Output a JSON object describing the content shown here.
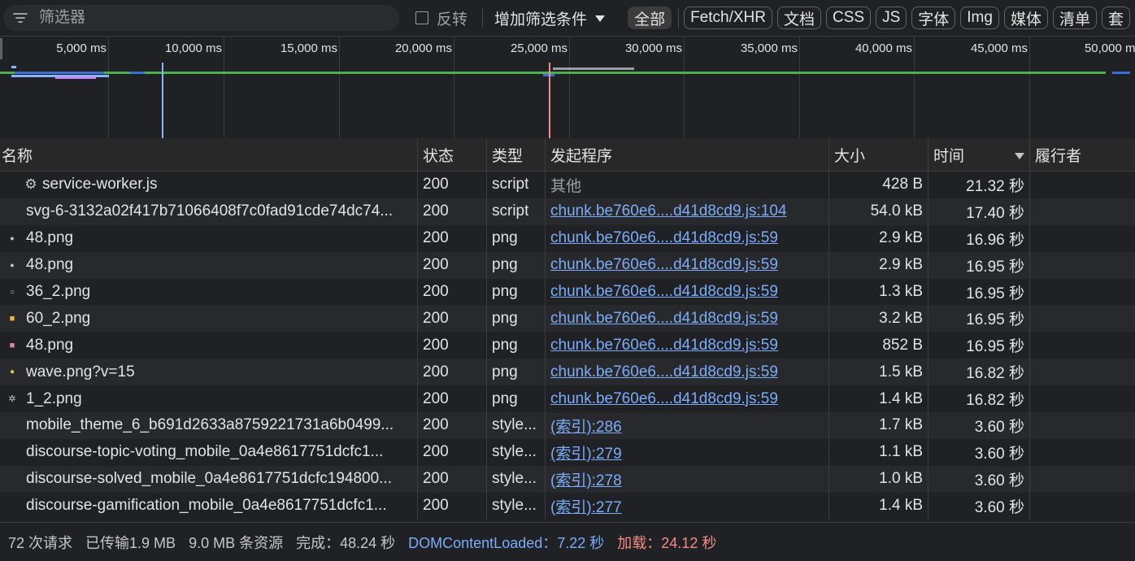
{
  "filter": {
    "placeholder": "筛选器",
    "invert_label": "反转",
    "more_filters_label": "增加筛选条件",
    "types": [
      "全部",
      "Fetch/XHR",
      "文档",
      "CSS",
      "JS",
      "字体",
      "Img",
      "媒体",
      "清单",
      "套"
    ]
  },
  "overview": {
    "ticks": [
      "5,000 ms",
      "10,000 ms",
      "15,000 ms",
      "20,000 ms",
      "25,000 ms",
      "30,000 ms",
      "35,000 ms",
      "40,000 ms",
      "45,000 ms",
      "50,000 ms"
    ],
    "dom_content_loaded_color": "#8ab4f8",
    "load_color": "#f28b82"
  },
  "table": {
    "headers": {
      "name": "名称",
      "status": "状态",
      "type": "类型",
      "initiator": "发起程序",
      "size": "大小",
      "time": "时间",
      "fulfilled_by": "履行者"
    },
    "rows": [
      {
        "icon": "gear-icon",
        "name": "service-worker.js",
        "status": "200",
        "type": "script",
        "initiator": "其他",
        "initiator_link": false,
        "size": "428 B",
        "time": "21.32 秒"
      },
      {
        "icon": "",
        "name": "svg-6-3132a02f417b71066408f7c0fad91cde74dc74...",
        "status": "200",
        "type": "script",
        "initiator": "chunk.be760e6....d41d8cd9.js:104",
        "initiator_link": true,
        "size": "54.0 kB",
        "time": "17.40 秒"
      },
      {
        "icon": "avatar-thumb-icon",
        "name": "48.png",
        "status": "200",
        "type": "png",
        "initiator": "chunk.be760e6....d41d8cd9.js:59",
        "initiator_link": true,
        "size": "2.9 kB",
        "time": "16.96 秒"
      },
      {
        "icon": "avatar-thumb-icon",
        "name": "48.png",
        "status": "200",
        "type": "png",
        "initiator": "chunk.be760e6....d41d8cd9.js:59",
        "initiator_link": true,
        "size": "2.9 kB",
        "time": "16.95 秒"
      },
      {
        "icon": "circle-thumb-icon",
        "name": "36_2.png",
        "status": "200",
        "type": "png",
        "initiator": "chunk.be760e6....d41d8cd9.js:59",
        "initiator_link": true,
        "size": "1.3 kB",
        "time": "16.95 秒"
      },
      {
        "icon": "yellow-thumb-icon",
        "name": "60_2.png",
        "status": "200",
        "type": "png",
        "initiator": "chunk.be760e6....d41d8cd9.js:59",
        "initiator_link": true,
        "size": "3.2 kB",
        "time": "16.95 秒"
      },
      {
        "icon": "pink-thumb-icon",
        "name": "48.png",
        "status": "200",
        "type": "png",
        "initiator": "chunk.be760e6....d41d8cd9.js:59",
        "initiator_link": true,
        "size": "852 B",
        "time": "16.95 秒"
      },
      {
        "icon": "wave-thumb-icon",
        "name": "wave.png?v=15",
        "status": "200",
        "type": "png",
        "initiator": "chunk.be760e6....d41d8cd9.js:59",
        "initiator_link": true,
        "size": "1.5 kB",
        "time": "16.82 秒"
      },
      {
        "icon": "cog-thumb-icon",
        "name": "1_2.png",
        "status": "200",
        "type": "png",
        "initiator": "chunk.be760e6....d41d8cd9.js:59",
        "initiator_link": true,
        "size": "1.4 kB",
        "time": "16.82 秒"
      },
      {
        "icon": "",
        "name": "mobile_theme_6_b691d2633a8759221731a6b0499...",
        "status": "200",
        "type": "style...",
        "initiator": "(索引):286",
        "initiator_link": true,
        "size": "1.7 kB",
        "time": "3.60 秒"
      },
      {
        "icon": "",
        "name": "discourse-topic-voting_mobile_0a4e8617751dcfc1...",
        "status": "200",
        "type": "style...",
        "initiator": "(索引):279",
        "initiator_link": true,
        "size": "1.1 kB",
        "time": "3.60 秒"
      },
      {
        "icon": "",
        "name": "discourse-solved_mobile_0a4e8617751dcfc194800...",
        "status": "200",
        "type": "style...",
        "initiator": "(索引):278",
        "initiator_link": true,
        "size": "1.0 kB",
        "time": "3.60 秒"
      },
      {
        "icon": "",
        "name": "discourse-gamification_mobile_0a4e8617751dcfc1...",
        "status": "200",
        "type": "style...",
        "initiator": "(索引):277",
        "initiator_link": true,
        "size": "1.4 kB",
        "time": "3.60 秒"
      }
    ]
  },
  "status_bar": {
    "requests": "72 次请求",
    "transferred": "已传输1.9 MB",
    "resources": "9.0 MB 条资源",
    "finish": "完成：48.24 秒",
    "dom_content_loaded": "DOMContentLoaded：7.22 秒",
    "load": "加载：24.12 秒"
  }
}
